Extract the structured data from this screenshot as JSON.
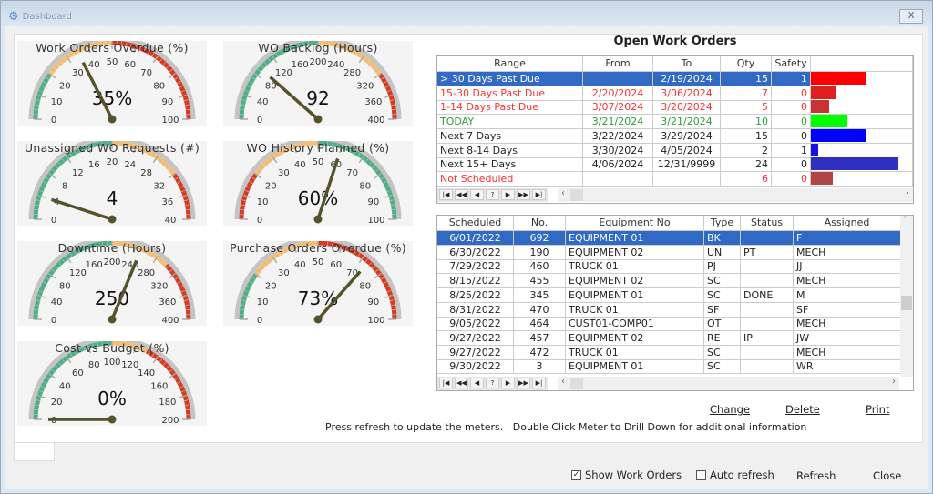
{
  "window": {
    "title": "Dashboard",
    "close_label": "X"
  },
  "gauges": [
    {
      "title": "Work Orders Overdue (%)",
      "min": 0,
      "max": 100,
      "ticks": [
        "0",
        "10",
        "20",
        "30",
        "40",
        "50",
        "60",
        "70",
        "80",
        "90",
        "100"
      ],
      "value": 35,
      "display": "35%",
      "bands": [
        [
          0,
          20,
          "#4caf86"
        ],
        [
          20,
          50,
          "#f8c070"
        ],
        [
          50,
          100,
          "#d83a20"
        ]
      ]
    },
    {
      "title": "WO Backlog (Hours)",
      "min": 0,
      "max": 400,
      "ticks": [
        "0",
        "40",
        "80",
        "120",
        "160",
        "200",
        "240",
        "280",
        "320",
        "360",
        "400"
      ],
      "value": 92,
      "display": "92",
      "bands": [
        [
          0,
          200,
          "#4caf86"
        ],
        [
          200,
          320,
          "#f8c070"
        ],
        [
          320,
          400,
          "#d83a20"
        ]
      ]
    },
    {
      "title": "Unassigned WO Requests (#)",
      "min": 0,
      "max": 40,
      "ticks": [
        "0",
        "4",
        "8",
        "12",
        "16",
        "20",
        "24",
        "28",
        "32",
        "36",
        "40"
      ],
      "value": 4,
      "display": "4",
      "bands": [
        [
          0,
          20,
          "#4caf86"
        ],
        [
          20,
          32,
          "#f8c070"
        ],
        [
          32,
          40,
          "#d83a20"
        ]
      ]
    },
    {
      "title": "WO History Planned (%)",
      "min": 0,
      "max": 100,
      "ticks": [
        "0",
        "10",
        "20",
        "30",
        "40",
        "50",
        "60",
        "70",
        "80",
        "90",
        "100"
      ],
      "value": 60,
      "display": "60%",
      "bands": [
        [
          0,
          20,
          "#d83a20"
        ],
        [
          20,
          50,
          "#f8c070"
        ],
        [
          50,
          100,
          "#4caf86"
        ]
      ]
    },
    {
      "title": "Downtime (Hours)",
      "min": 0,
      "max": 400,
      "ticks": [
        "0",
        "40",
        "80",
        "120",
        "160",
        "200",
        "240",
        "280",
        "320",
        "360",
        "400"
      ],
      "value": 250,
      "display": "250",
      "bands": [
        [
          0,
          200,
          "#4caf86"
        ],
        [
          200,
          300,
          "#f8c070"
        ],
        [
          300,
          400,
          "#d83a20"
        ]
      ]
    },
    {
      "title": "Purchase Orders Overdue (%)",
      "min": 0,
      "max": 100,
      "ticks": [
        "0",
        "10",
        "20",
        "30",
        "40",
        "50",
        "60",
        "70",
        "80",
        "90",
        "100"
      ],
      "value": 73,
      "display": "73%",
      "bands": [
        [
          0,
          20,
          "#4caf86"
        ],
        [
          20,
          50,
          "#f8c070"
        ],
        [
          50,
          100,
          "#d83a20"
        ]
      ]
    },
    {
      "title": "Cost vs Budget (%)",
      "min": 0,
      "max": 200,
      "ticks": [
        "0",
        "20",
        "40",
        "60",
        "80",
        "100",
        "120",
        "140",
        "160",
        "180",
        "200"
      ],
      "value": 0,
      "display": "0%",
      "bands": [
        [
          0,
          100,
          "#4caf86"
        ],
        [
          100,
          130,
          "#f8c070"
        ],
        [
          130,
          200,
          "#d83a20"
        ]
      ]
    }
  ],
  "open_wo": {
    "title": "Open Work Orders",
    "headers": [
      "Range",
      "From",
      "To",
      "Qty",
      "Safety"
    ],
    "rows": [
      {
        "range": "> 30 Days Past Due",
        "from": "",
        "to": "2/19/2024",
        "qty": 15,
        "safety": "1",
        "color": "#ffffff",
        "bar": "#ff0000",
        "selected": true
      },
      {
        "range": "15-30 Days Past Due",
        "from": "2/20/2024",
        "to": "3/06/2024",
        "qty": 7,
        "safety": "0",
        "color": "#ff3030",
        "bar": "#e02020"
      },
      {
        "range": "1-14 Days Past Due",
        "from": "3/07/2024",
        "to": "3/20/2024",
        "qty": 5,
        "safety": "0",
        "color": "#ff3030",
        "bar": "#c83434"
      },
      {
        "range": "TODAY",
        "from": "3/21/2024",
        "to": "3/21/2024",
        "qty": 10,
        "safety": "0",
        "color": "#2e9e3a",
        "bar": "#00ff00"
      },
      {
        "range": "Next 7 Days",
        "from": "3/22/2024",
        "to": "3/29/2024",
        "qty": 15,
        "safety": "0",
        "color": "#222222",
        "bar": "#0000ff"
      },
      {
        "range": "Next 8-14 Days",
        "from": "3/30/2024",
        "to": "4/05/2024",
        "qty": 2,
        "safety": "1",
        "color": "#222222",
        "bar": "#1414e0"
      },
      {
        "range": "Next 15+ Days",
        "from": "4/06/2024",
        "to": "12/31/9999",
        "qty": 24,
        "safety": "0",
        "color": "#222222",
        "bar": "#3030c0"
      },
      {
        "range": "Not Scheduled",
        "from": "",
        "to": "",
        "qty": 6,
        "safety": "0",
        "color": "#ff3030",
        "bar": "#b04545"
      }
    ]
  },
  "nav_buttons": [
    "|◀",
    "◀◀",
    "◀",
    "?",
    "▶",
    "▶▶",
    "▶|"
  ],
  "wo_list": {
    "headers": [
      "Scheduled",
      "No.",
      "Equipment No",
      "Type",
      "Status",
      "Assigned"
    ],
    "rows": [
      [
        "6/01/2022",
        "692",
        "EQUIPMENT 01",
        "BK",
        "",
        "F"
      ],
      [
        "6/30/2022",
        "190",
        "EQUIPMENT 02",
        "UN",
        "PT",
        "MECH"
      ],
      [
        "7/29/2022",
        "460",
        "TRUCK 01",
        "PJ",
        "",
        "JJ"
      ],
      [
        "8/15/2022",
        "455",
        "EQUIPMENT 02",
        "SC",
        "",
        "MECH"
      ],
      [
        "8/25/2022",
        "345",
        "EQUIPMENT 01",
        "SC",
        "DONE",
        "M"
      ],
      [
        "8/31/2022",
        "470",
        "TRUCK 01",
        "SF",
        "",
        "SF"
      ],
      [
        "9/05/2022",
        "464",
        "CUST01-COMP01",
        "OT",
        "",
        "MECH"
      ],
      [
        "9/27/2022",
        "457",
        "EQUIPMENT 02",
        "RE",
        "IP",
        "JW"
      ],
      [
        "9/27/2022",
        "472",
        "TRUCK 01",
        "SC",
        "",
        "MECH"
      ],
      [
        "9/30/2022",
        "3",
        "EQUIPMENT 01",
        "SC",
        "",
        "WR"
      ]
    ]
  },
  "actions": {
    "change": "Change",
    "delete": "Delete",
    "print": "Print"
  },
  "hint": "Press refresh to update the meters.   Double Click Meter to Drill Down for additional information",
  "footer": {
    "show_wo": "Show Work Orders",
    "show_wo_checked": true,
    "auto_refresh": "Auto refresh",
    "auto_refresh_checked": false,
    "refresh": "Refresh",
    "close": "Close"
  }
}
